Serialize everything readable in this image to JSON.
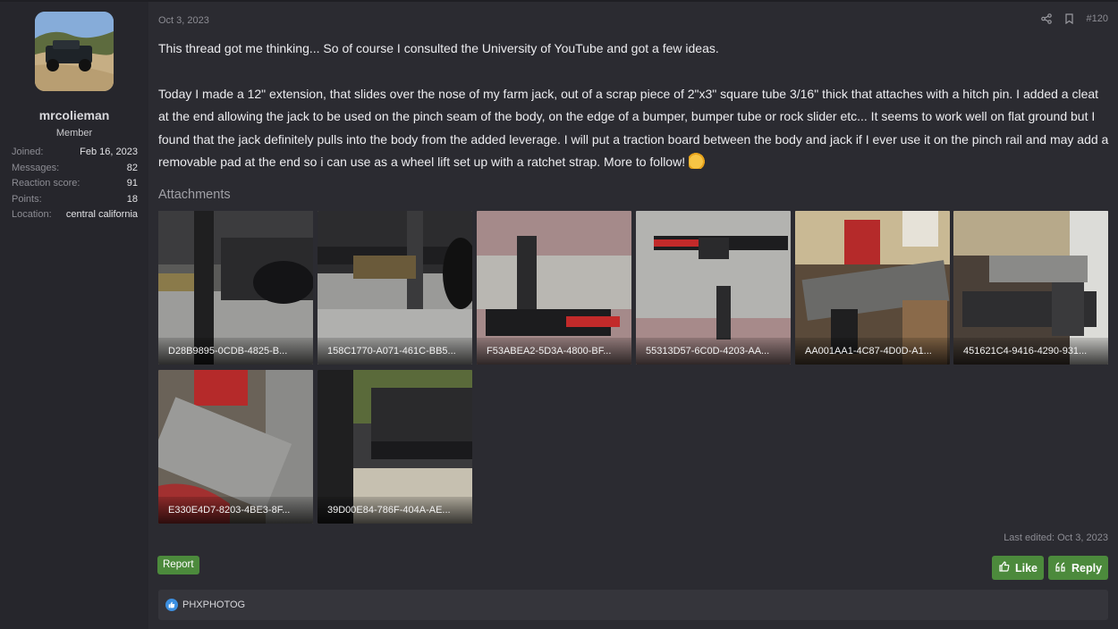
{
  "user": {
    "name": "mrcolieman",
    "title": "Member",
    "stats": [
      {
        "label": "Joined:",
        "value": "Feb 16, 2023"
      },
      {
        "label": "Messages:",
        "value": "82"
      },
      {
        "label": "Reaction score:",
        "value": "91"
      },
      {
        "label": "Points:",
        "value": "18"
      },
      {
        "label": "Location:",
        "value": "central california"
      }
    ]
  },
  "post": {
    "date": "Oct 3, 2023",
    "number": "#120",
    "paragraphs": [
      "This thread got me thinking... So of course I consulted the University of YouTube and got a few ideas.",
      "Today I made a 12\" extension, that slides over the nose of my farm jack, out of a scrap piece of 2\"x3\" square tube 3/16\" thick that attaches with a hitch pin. I added a cleat at the end allowing the jack to be used on the pinch seam of the body, on the edge of a bumper, bumper tube or rock slider etc... It seems to work well on flat ground but I found that the jack definitely pulls into the body from the added leverage. I will put a traction board between the body and jack if I ever use it on the pinch rail and may add a removable pad at the end so i can use as a wheel lift set up with a ratchet strap. More to follow!"
    ],
    "emoji": "thumbs-up-emoji",
    "attachments_title": "Attachments",
    "attachments": [
      {
        "name": "D28B9895-0CDB-4825-B..."
      },
      {
        "name": "158C1770-A071-461C-BB5..."
      },
      {
        "name": "F53ABEA2-5D3A-4800-BF..."
      },
      {
        "name": "55313D57-6C0D-4203-AA..."
      },
      {
        "name": "AA001AA1-4C87-4D0D-A1..."
      },
      {
        "name": "451621C4-9416-4290-931..."
      },
      {
        "name": "E330E4D7-8203-4BE3-8F..."
      },
      {
        "name": "39D00E84-786F-404A-AE..."
      }
    ],
    "last_edited": "Last edited: Oct 3, 2023"
  },
  "actions": {
    "report": "Report",
    "like": "Like",
    "reply": "Reply"
  },
  "reactions": {
    "users": "PHXPHOTOG"
  },
  "colors": {
    "background": "#2b2b31",
    "sidebar": "#26262c",
    "accent_green": "#4c8a3c",
    "like_blue": "#3c8fe0"
  }
}
